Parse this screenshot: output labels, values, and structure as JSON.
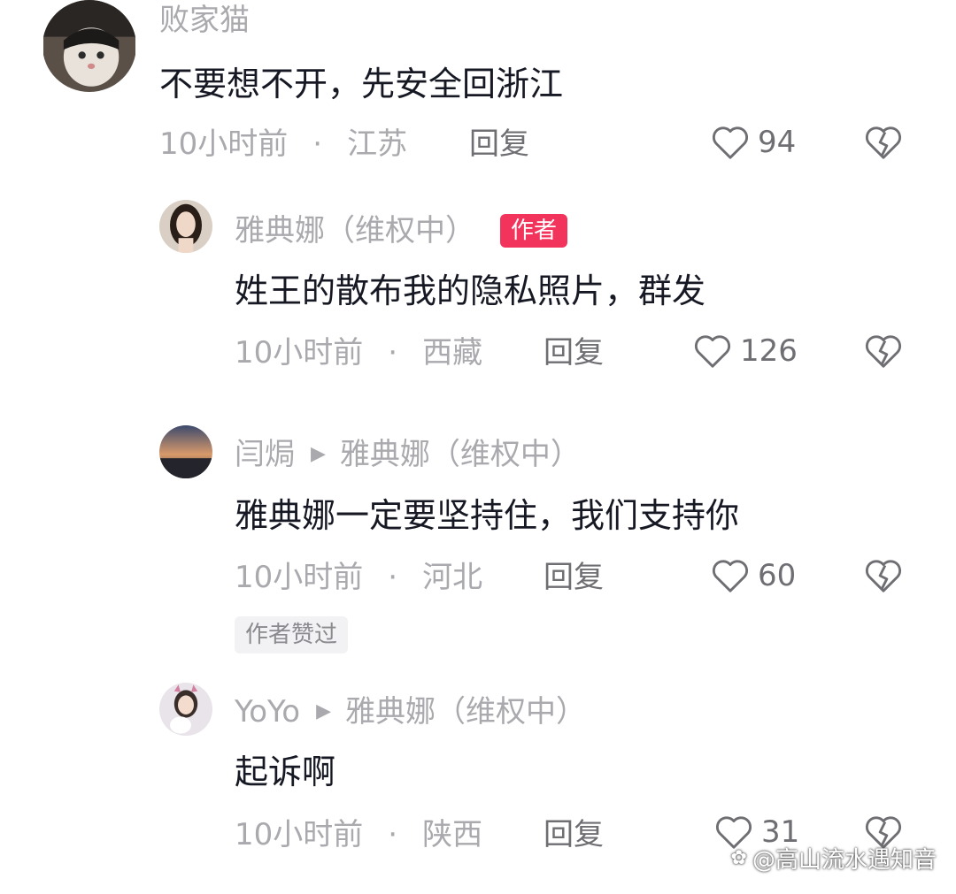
{
  "comments": [
    {
      "name": "败家猫",
      "text": "不要想不开，先安全回浙江",
      "time": "10小时前",
      "dot": "·",
      "location": "江苏",
      "reply": "回复",
      "likes": "94"
    },
    {
      "name": "雅典娜（维权中）",
      "badge": "作者",
      "text": "姓王的散布我的隐私照片，群发",
      "time": "10小时前",
      "dot": "·",
      "location": "西藏",
      "reply": "回复",
      "likes": "126"
    },
    {
      "name": "闫焗",
      "reply_to": "雅典娜（维权中）",
      "text": "雅典娜一定要坚持住，我们支持你",
      "time": "10小时前",
      "dot": "·",
      "location": "河北",
      "reply": "回复",
      "likes": "60",
      "tag": "作者赞过"
    },
    {
      "name": "YoYo",
      "reply_to": "雅典娜（维权中）",
      "text": "起诉啊",
      "time": "10小时前",
      "dot": "·",
      "location": "陕西",
      "reply": "回复",
      "likes": "31"
    }
  ],
  "watermark": "@高山流水遇知音",
  "icons": {
    "like": "heart-outline-icon",
    "dislike": "broken-heart-icon",
    "reply_arrow": "play-triangle-icon"
  },
  "colors": {
    "text": "#161823",
    "muted": "#a9a9ae",
    "badge": "#f2335c"
  }
}
